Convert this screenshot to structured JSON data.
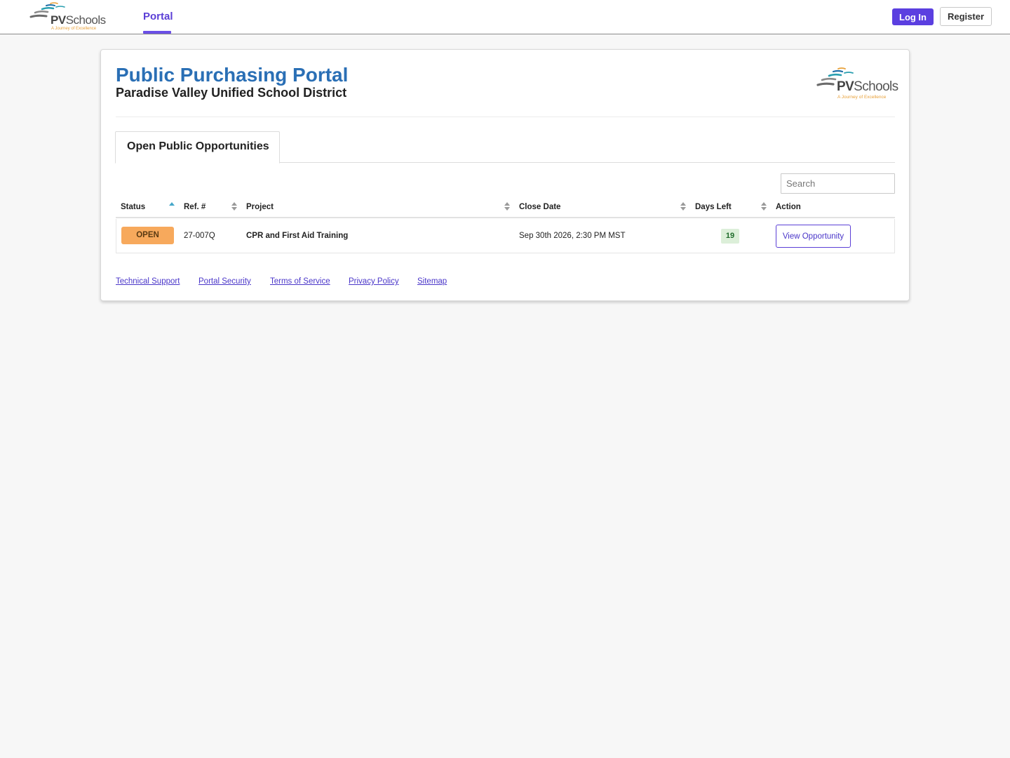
{
  "brand": {
    "name_bold": "PV",
    "name_rest": "Schools",
    "tagline": "A Journey of Excellence"
  },
  "nav": {
    "active_tab": "Portal",
    "login_label": "Log In",
    "register_label": "Register"
  },
  "header": {
    "title": "Public Purchasing Portal",
    "subtitle": "Paradise Valley Unified School District"
  },
  "tabs": {
    "active": "Open Public Opportunities"
  },
  "search": {
    "placeholder": "Search",
    "value": ""
  },
  "table": {
    "columns": {
      "status": "Status",
      "ref": "Ref. #",
      "project": "Project",
      "close_date": "Close Date",
      "days_left": "Days Left",
      "action": "Action"
    },
    "sorted_by": "Status",
    "sort_direction": "ascending",
    "rows": [
      {
        "status": "OPEN",
        "ref": "27-007Q",
        "project": "CPR and First Aid Training",
        "close_date": "Sep 30th 2026, 2:30 PM MST",
        "days_left": "19",
        "action": "View Opportunity"
      }
    ]
  },
  "footer": {
    "links": [
      "Technical Support",
      "Portal Security",
      "Terms of Service",
      "Privacy Policy",
      "Sitemap"
    ]
  },
  "colors": {
    "accent": "#5b3fe0",
    "title_blue": "#2a6fb5",
    "status_open": "#f7a95c",
    "days_badge": "#dcefd9",
    "logo_teal": "#2a9fb0",
    "logo_orange": "#e8a13a"
  },
  "icons": {
    "logo": "pvschools-swoosh-logo",
    "sort": "sort-arrows-icon",
    "sort_asc": "sort-ascending-icon"
  }
}
